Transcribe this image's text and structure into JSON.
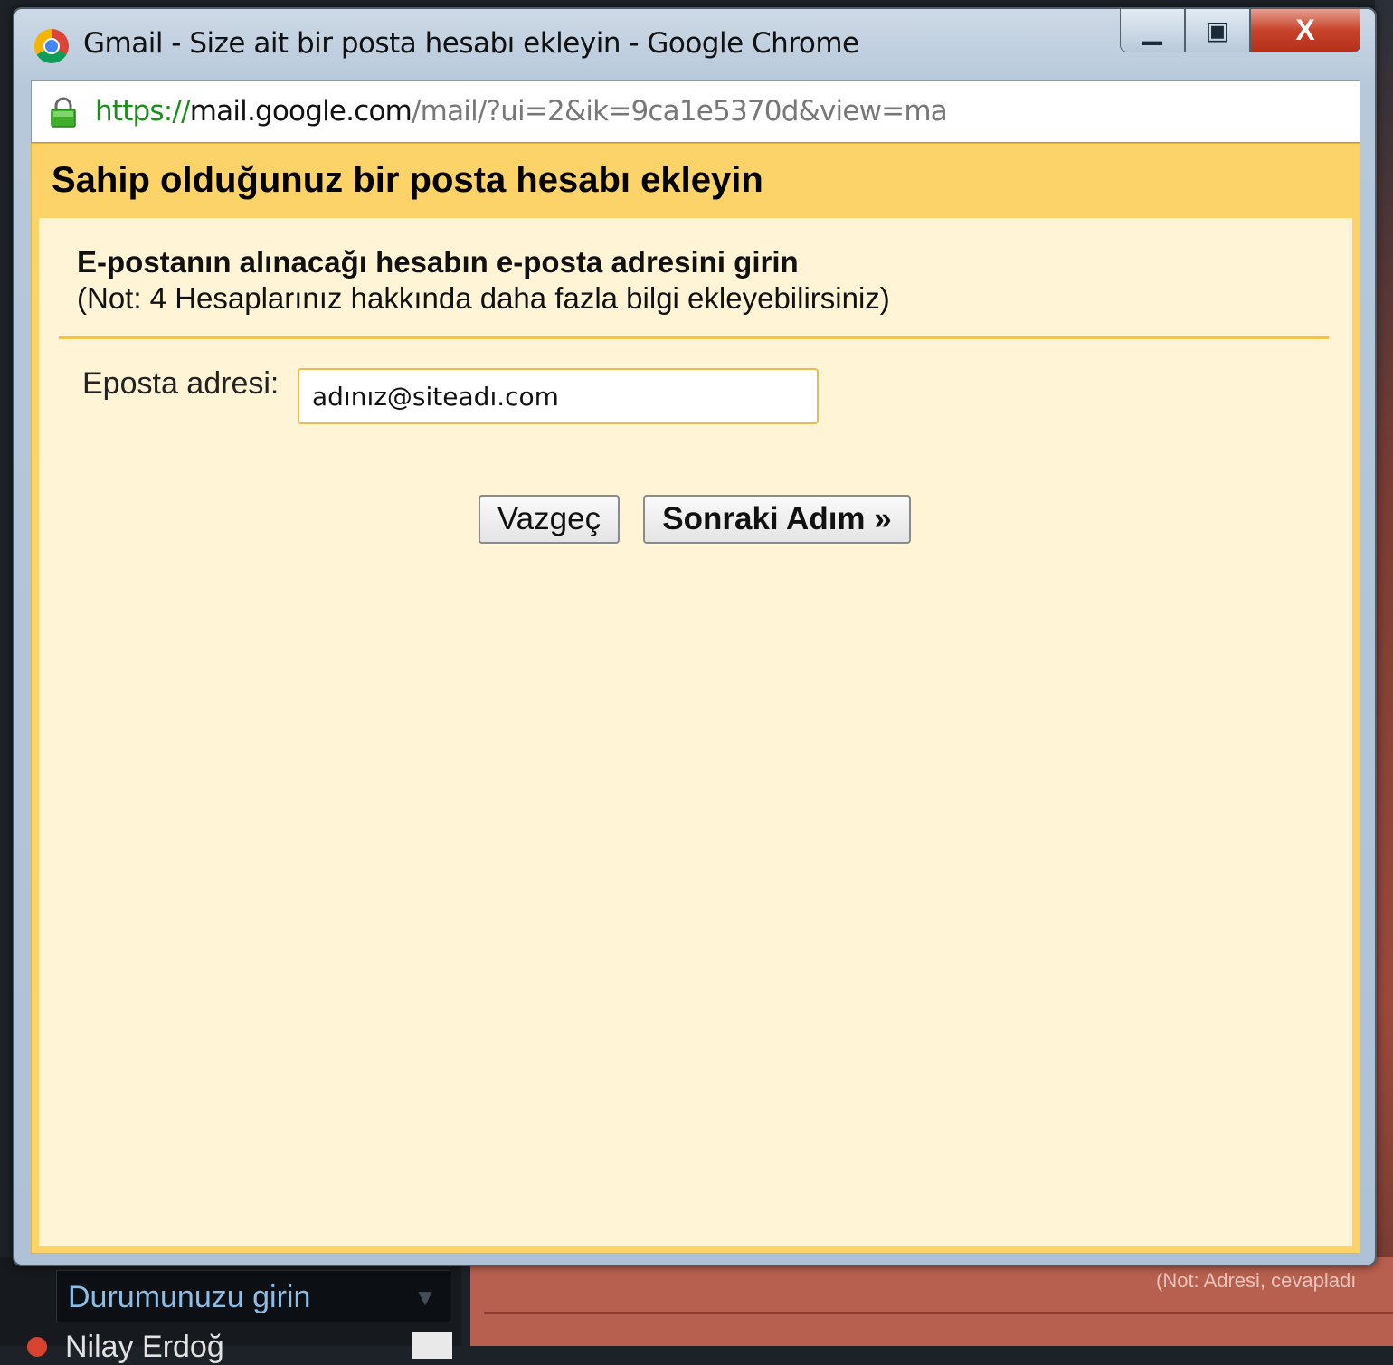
{
  "window": {
    "title": "Gmail - Size ait bir posta hesabı ekleyin - Google Chrome",
    "minimize_label": "▁",
    "maximize_label": "▣",
    "close_label": "X"
  },
  "addressbar": {
    "scheme": "https://",
    "host": "mail.google.com",
    "path": "/mail/?ui=2&ik=9ca1e5370d&view=ma"
  },
  "dialog": {
    "title": "Sahip olduğunuz bir posta hesabı ekleyin",
    "heading": "E-postanın alınacağı hesabın e-posta adresini girin",
    "note": "(Not: 4 Hesaplarınız hakkında daha fazla bilgi ekleyebilirsiniz)",
    "email_label": "Eposta adresi:",
    "email_value": "adınız@siteadı.com",
    "cancel_label": "Vazgeç",
    "next_label": "Sonraki Adım »"
  },
  "background": {
    "status_placeholder": "Durumunuzu girin",
    "status_arrow": "▼",
    "contact_name": "Nilay Erdoğ",
    "note_text": "(Not: Adresi, cevapladı"
  },
  "colors": {
    "dialog_header": "#fcd368",
    "dialog_body": "#fff4d6",
    "url_secure_green": "#1b8e1b"
  }
}
